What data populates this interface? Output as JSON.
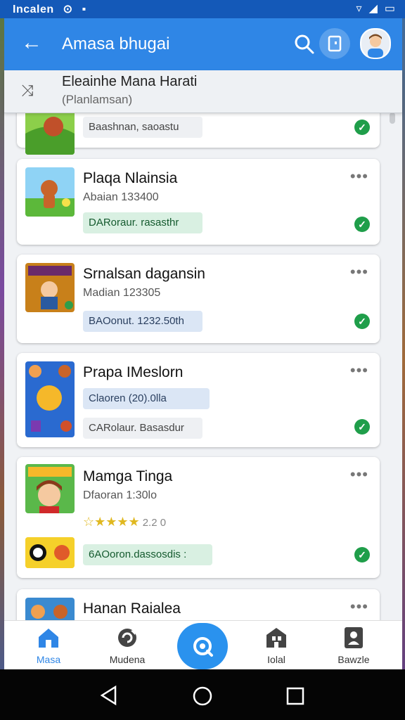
{
  "status_bar": {
    "text": "Incalen",
    "icons": [
      "camera-icon",
      "image-icon",
      "signal-icon",
      "wifi-icon",
      "battery-icon"
    ]
  },
  "app_bar": {
    "title": "Amasa bhugai",
    "icons": [
      "back-arrow-icon",
      "search-icon",
      "bookmark-icon",
      "avatar"
    ]
  },
  "subheader": {
    "title": "Eleainhe Mana Harati",
    "subtitle": "(Planlamsan)"
  },
  "items": [
    {
      "name": "",
      "meta": "",
      "pills": [
        {
          "text": "Baashnan, saoastu",
          "style": "grey"
        }
      ],
      "checked": true
    },
    {
      "name": "Plaqa Nlainsia",
      "meta": "Abaian 133400",
      "pills": [
        {
          "text": "DARoraur. rasasthr",
          "style": "green"
        }
      ],
      "checked": true
    },
    {
      "name": "Srnalsan dagansin",
      "meta": "Madian 123305",
      "pills": [
        {
          "text": "BAOonut. 1232.50th",
          "style": "blue"
        }
      ],
      "checked": true
    },
    {
      "name": "Prapa IMeslorn",
      "meta": "",
      "pills": [
        {
          "text": "Claoren (20).0lla",
          "style": "blue"
        },
        {
          "text": "CARolaur. Basasdur",
          "style": "grey"
        }
      ],
      "checked": true
    },
    {
      "name": "Mamga Tinga",
      "meta": "Dfaoran 1:30lo",
      "stars": "2.2 0",
      "pills": [
        {
          "text": "6AOoron.dassosdis :",
          "style": "green"
        }
      ],
      "checked": true
    },
    {
      "name": "Hanan Raialea",
      "meta": "",
      "pills": [],
      "checked": false
    }
  ],
  "bottom_nav": [
    {
      "label": "Masa",
      "icon": "home-icon",
      "active": true
    },
    {
      "label": "Mudena",
      "icon": "refresh-icon",
      "active": false
    },
    {
      "label": "",
      "icon": "search-fab-icon",
      "active": false
    },
    {
      "label": "Iolal",
      "icon": "building-icon",
      "active": false
    },
    {
      "label": "Bawzle",
      "icon": "profile-card-icon",
      "active": false
    }
  ],
  "colors": {
    "primary": "#2f86e6",
    "status": "#1459b8",
    "check": "#1f9e4a"
  }
}
